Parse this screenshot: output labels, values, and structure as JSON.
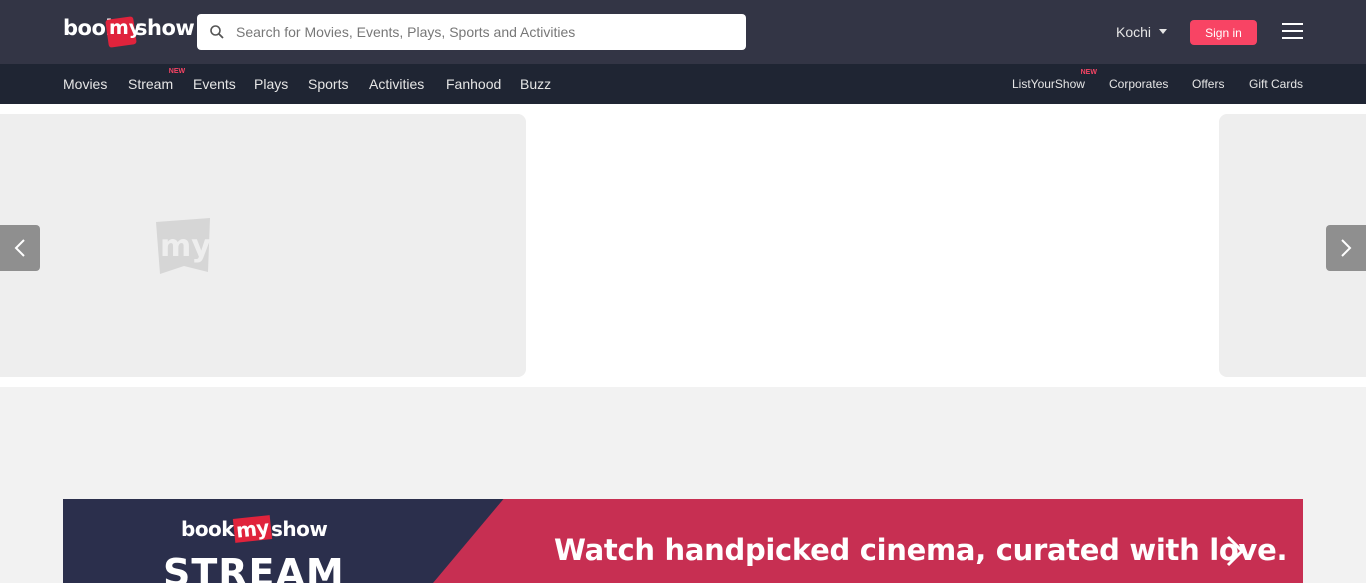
{
  "header": {
    "logo_text": "bookmyshow",
    "logo_parts": [
      "book",
      "my",
      "show"
    ],
    "search_placeholder": "Search for Movies, Events, Plays, Sports and Activities",
    "city": "Kochi",
    "signin_label": "Sign in"
  },
  "nav": {
    "left_items": [
      {
        "label": "Movies"
      },
      {
        "label": "Stream",
        "badge": "NEW"
      },
      {
        "label": "Events"
      },
      {
        "label": "Plays"
      },
      {
        "label": "Sports"
      },
      {
        "label": "Activities"
      },
      {
        "label": "Fanhood"
      },
      {
        "label": "Buzz"
      }
    ],
    "right_items": [
      {
        "label": "ListYourShow",
        "badge": "NEW"
      },
      {
        "label": "Corporates"
      },
      {
        "label": "Offers"
      },
      {
        "label": "Gift Cards"
      }
    ]
  },
  "carousel": {
    "placeholder_logo": "my",
    "prev_icon": "chevron-left-icon",
    "next_icon": "chevron-right-icon"
  },
  "stream_banner": {
    "brand_parts": [
      "book",
      "my",
      "show"
    ],
    "product": "STREAM",
    "tagline": "Watch handpicked cinema, curated with love.",
    "arrow_icon": "chevron-right-icon"
  },
  "colors": {
    "topbar": "#333545",
    "navbar": "#1f2533",
    "accent": "#f84464",
    "banner_dark": "#2b2f4c",
    "banner_pink": "#c72f52"
  }
}
